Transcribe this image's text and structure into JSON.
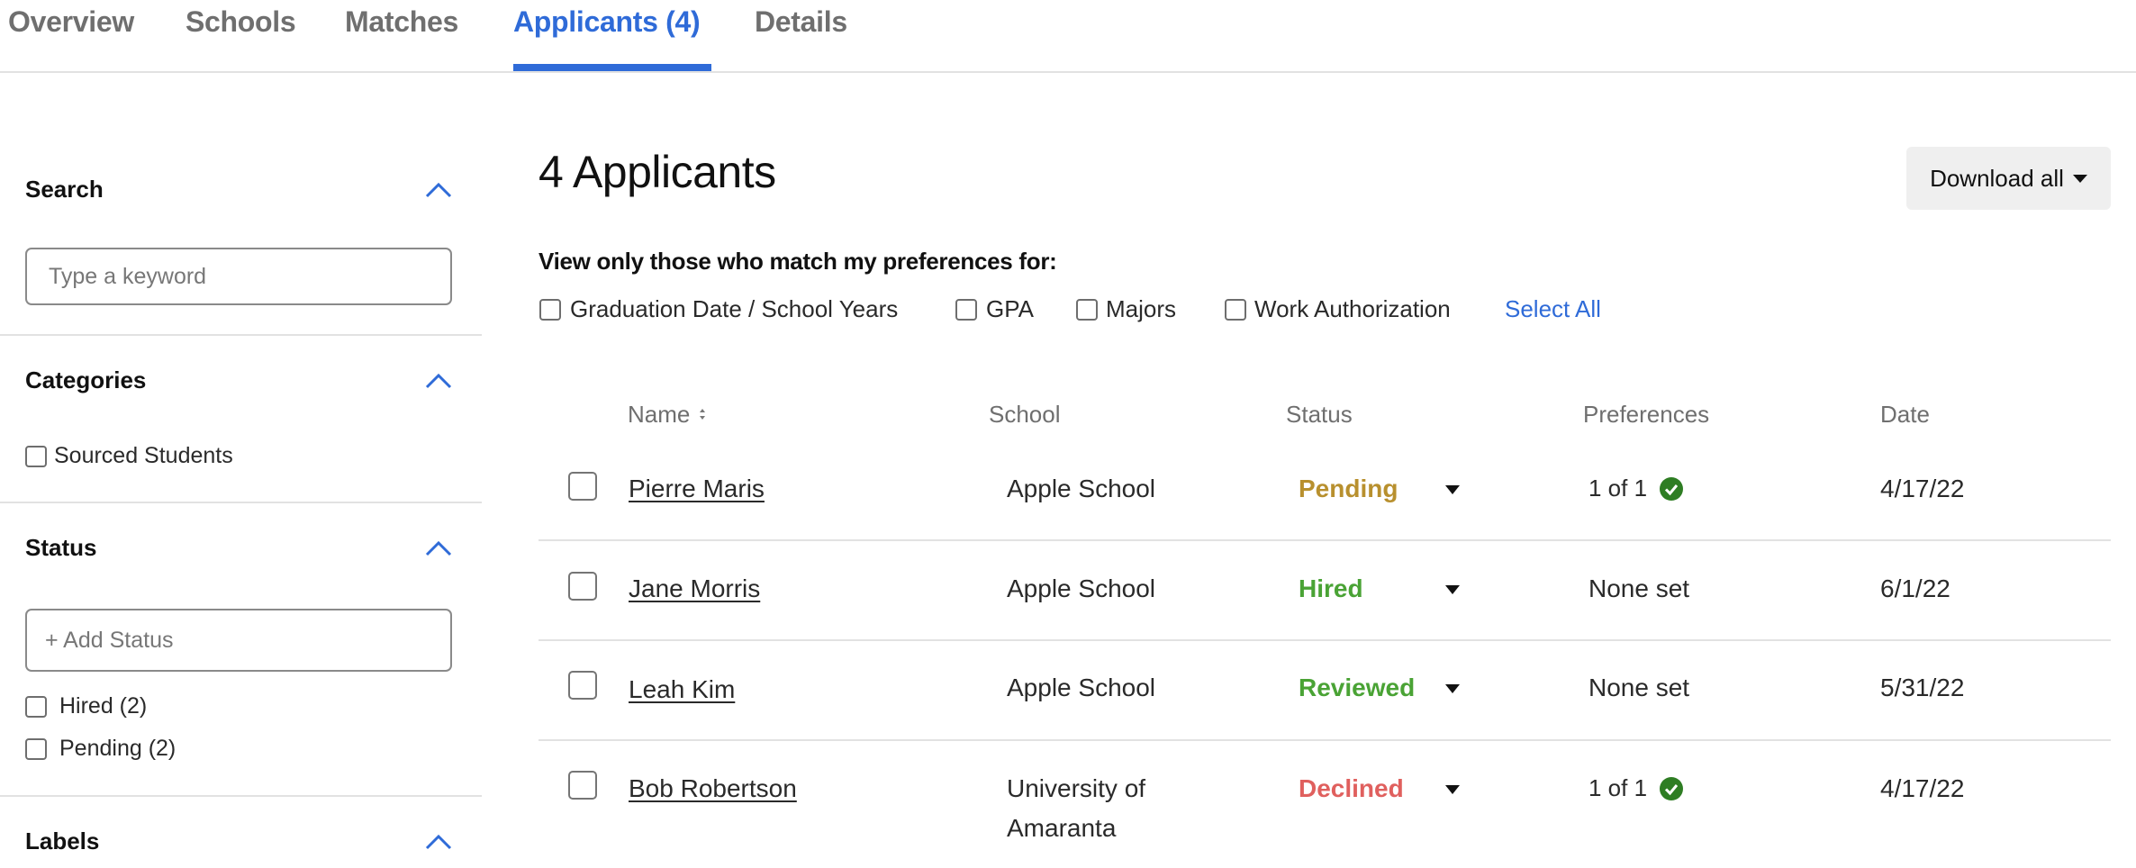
{
  "tabs": [
    {
      "label": "Overview",
      "active": false
    },
    {
      "label": "Schools",
      "active": false
    },
    {
      "label": "Matches",
      "active": false
    },
    {
      "label": "Applicants (4)",
      "active": true
    },
    {
      "label": "Details",
      "active": false
    }
  ],
  "sidebar": {
    "search": {
      "heading": "Search",
      "placeholder": "Type a keyword",
      "value": ""
    },
    "categories": {
      "heading": "Categories",
      "options": [
        {
          "label": "Sourced Students",
          "checked": false
        }
      ]
    },
    "status": {
      "heading": "Status",
      "placeholder": "+ Add Status",
      "options": [
        {
          "label": "Hired (2)",
          "checked": false
        },
        {
          "label": "Pending (2)",
          "checked": false
        }
      ]
    },
    "labels": {
      "heading": "Labels"
    }
  },
  "main": {
    "title": "4 Applicants",
    "download_label": "Download all",
    "preferences_heading": "View only those who match my preferences for:",
    "preference_options": [
      {
        "label": "Graduation Date / School Years",
        "checked": false
      },
      {
        "label": "GPA",
        "checked": false
      },
      {
        "label": "Majors",
        "checked": false
      },
      {
        "label": "Work Authorization",
        "checked": false
      }
    ],
    "select_all_label": "Select All"
  },
  "table": {
    "columns": [
      "Name",
      "School",
      "Status",
      "Preferences",
      "Date"
    ],
    "rows": [
      {
        "name": "Pierre Maris",
        "school": "Apple School",
        "status": "Pending",
        "status_color": "#b8902e",
        "preferences": "1 of 1",
        "preferences_match": true,
        "date": "4/17/22"
      },
      {
        "name": "Jane Morris",
        "school": "Apple School",
        "status": "Hired",
        "status_color": "#4aa335",
        "preferences": "None set",
        "preferences_match": false,
        "date": "6/1/22"
      },
      {
        "name": "Leah Kim",
        "school": "Apple School",
        "status": "Reviewed",
        "status_color": "#4aa335",
        "preferences": "None set",
        "preferences_match": false,
        "date": "5/31/22"
      },
      {
        "name": "Bob Robertson",
        "school": "University of Amaranta",
        "status": "Declined",
        "status_color": "#e0605e",
        "preferences": "1 of 1",
        "preferences_match": true,
        "date": "4/17/22"
      }
    ]
  },
  "colors": {
    "accent": "#2f6bd8",
    "check_green": "#2e7d23",
    "divider": "#e2e2e2"
  }
}
